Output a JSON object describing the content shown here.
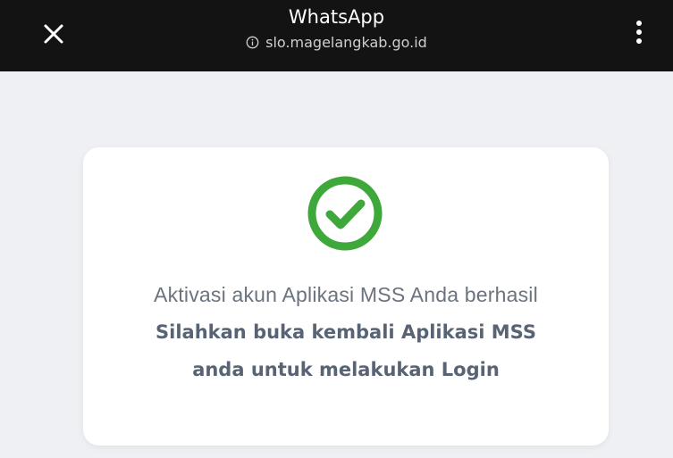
{
  "browser": {
    "title": "WhatsApp",
    "url": "slo.magelangkab.go.id",
    "close_icon": "close-icon",
    "menu_icon": "more-vertical-icon",
    "info_icon": "info-icon"
  },
  "card": {
    "status_icon": "check-circle-icon",
    "message": "Aktivasi akun Aplikasi MSS Anda berhasil",
    "instruction_line1": "Silahkan buka kembali Aplikasi MSS",
    "instruction_line2": "anda untuk melakukan Login"
  },
  "colors": {
    "topbar": "#131313",
    "background": "#eef0f3",
    "success_green": "#3fa83b",
    "text": "#586474"
  }
}
